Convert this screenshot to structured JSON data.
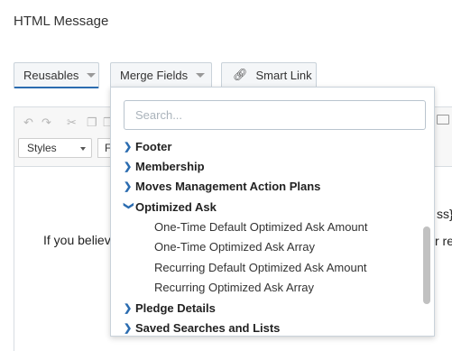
{
  "page": {
    "label": "HTML Message"
  },
  "toolbar": {
    "reusables_label": "Reusables",
    "merge_fields_label": "Merge Fields",
    "smart_link_label": "Smart Link"
  },
  "editor": {
    "styles_label": "Styles",
    "format_label": "F",
    "body_text": "If you believe",
    "right_text_1": "ss}",
    "right_text_2": "r re"
  },
  "dropdown": {
    "search_placeholder": "Search...",
    "items": [
      {
        "label": "Footer",
        "type": "group",
        "expanded": false
      },
      {
        "label": "Membership",
        "type": "group",
        "expanded": false
      },
      {
        "label": "Moves Management Action Plans",
        "type": "group",
        "expanded": false
      },
      {
        "label": "Optimized Ask",
        "type": "group",
        "expanded": true
      },
      {
        "label": "One-Time Default Optimized Ask Amount",
        "type": "child"
      },
      {
        "label": "One-Time Optimized Ask Array",
        "type": "child"
      },
      {
        "label": "Recurring Default Optimized Ask Amount",
        "type": "child"
      },
      {
        "label": "Recurring Optimized Ask Array",
        "type": "child"
      },
      {
        "label": "Pledge Details",
        "type": "group",
        "expanded": false
      },
      {
        "label": "Saved Searches and Lists",
        "type": "group",
        "expanded": false
      }
    ]
  },
  "icons": {
    "collapsed": "chevron-right-icon",
    "expanded": "chevron-down-icon",
    "link": "link-icon",
    "caret": "caret-down-icon"
  },
  "colors": {
    "accent": "#2b6cb0"
  }
}
